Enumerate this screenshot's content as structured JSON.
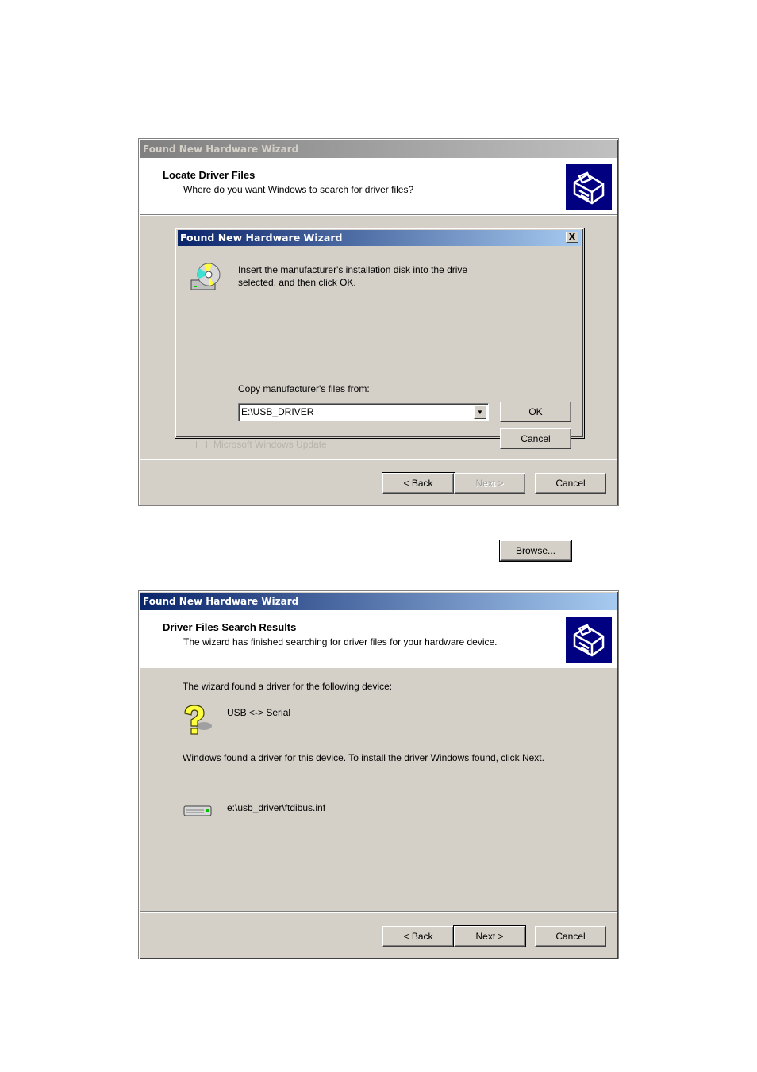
{
  "window1": {
    "title": "Found New Hardware Wizard",
    "header_title": "Locate Driver Files",
    "header_subtitle": "Where do you want Windows to search for driver files?",
    "ghost_checkbox_label": "Microsoft Windows Update",
    "buttons": {
      "back": "< Back",
      "next": "Next >",
      "cancel": "Cancel"
    },
    "dialog": {
      "title": "Found New Hardware Wizard",
      "close_label": "X",
      "message": "Insert the manufacturer's installation disk into the drive selected, and then click OK.",
      "ok": "OK",
      "cancel": "Cancel",
      "copy_label": "Copy manufacturer's files from:",
      "copy_from_value": "E:\\USB_DRIVER",
      "browse": "Browse..."
    }
  },
  "window2": {
    "title": "Found New Hardware Wizard",
    "header_title": "Driver Files Search Results",
    "header_subtitle": "The wizard has finished searching for driver files for your hardware device.",
    "found_label": "The wizard found a driver for the following device:",
    "device_name": "USB <-> Serial",
    "instruction": "Windows found a driver for this device. To install the driver Windows found, click Next.",
    "driver_path": "e:\\usb_driver\\ftdibus.inf",
    "buttons": {
      "back": "< Back",
      "next": "Next >",
      "cancel": "Cancel"
    }
  }
}
